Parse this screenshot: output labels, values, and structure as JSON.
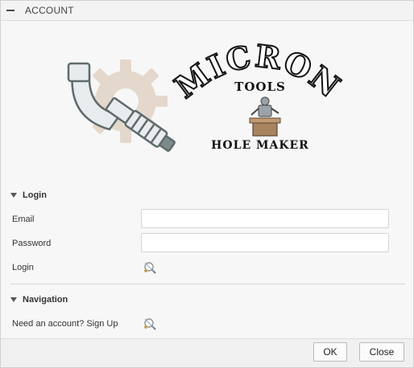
{
  "dialog": {
    "title": "ACCOUNT"
  },
  "logo": {
    "brand": "MICRON",
    "subtitle": "TOOLS",
    "tagline": "HOLE MAKER"
  },
  "login": {
    "header": "Login",
    "email_label": "Email",
    "email_value": "",
    "password_label": "Password",
    "password_value": "",
    "login_label": "Login"
  },
  "navigation": {
    "header": "Navigation",
    "signup_label": "Need an account? Sign Up"
  },
  "footer": {
    "ok_label": "OK",
    "close_label": "Close"
  },
  "colors": {
    "gear": "#e4d8cc",
    "micrometer_outline": "#5f6b6c",
    "micrometer_fill": "#e9ecef",
    "logo_text": "#111111"
  }
}
